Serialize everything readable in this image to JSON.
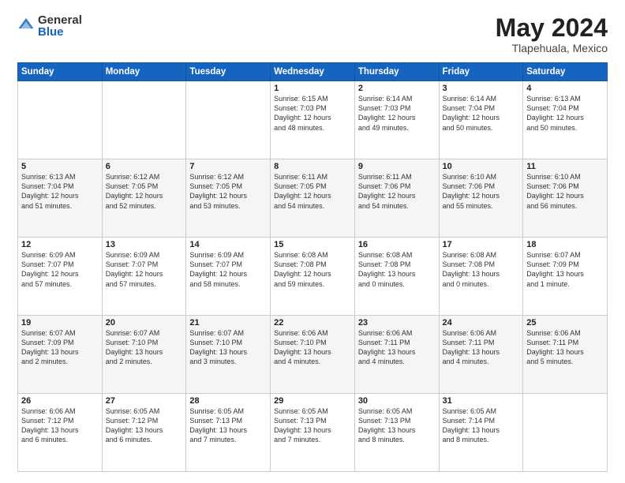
{
  "header": {
    "logo_general": "General",
    "logo_blue": "Blue",
    "title": "May 2024",
    "location": "Tlapehuala, Mexico"
  },
  "columns": [
    "Sunday",
    "Monday",
    "Tuesday",
    "Wednesday",
    "Thursday",
    "Friday",
    "Saturday"
  ],
  "weeks": [
    [
      {
        "day": "",
        "info": ""
      },
      {
        "day": "",
        "info": ""
      },
      {
        "day": "",
        "info": ""
      },
      {
        "day": "1",
        "info": "Sunrise: 6:15 AM\nSunset: 7:03 PM\nDaylight: 12 hours\nand 48 minutes."
      },
      {
        "day": "2",
        "info": "Sunrise: 6:14 AM\nSunset: 7:03 PM\nDaylight: 12 hours\nand 49 minutes."
      },
      {
        "day": "3",
        "info": "Sunrise: 6:14 AM\nSunset: 7:04 PM\nDaylight: 12 hours\nand 50 minutes."
      },
      {
        "day": "4",
        "info": "Sunrise: 6:13 AM\nSunset: 7:04 PM\nDaylight: 12 hours\nand 50 minutes."
      }
    ],
    [
      {
        "day": "5",
        "info": "Sunrise: 6:13 AM\nSunset: 7:04 PM\nDaylight: 12 hours\nand 51 minutes."
      },
      {
        "day": "6",
        "info": "Sunrise: 6:12 AM\nSunset: 7:05 PM\nDaylight: 12 hours\nand 52 minutes."
      },
      {
        "day": "7",
        "info": "Sunrise: 6:12 AM\nSunset: 7:05 PM\nDaylight: 12 hours\nand 53 minutes."
      },
      {
        "day": "8",
        "info": "Sunrise: 6:11 AM\nSunset: 7:05 PM\nDaylight: 12 hours\nand 54 minutes."
      },
      {
        "day": "9",
        "info": "Sunrise: 6:11 AM\nSunset: 7:06 PM\nDaylight: 12 hours\nand 54 minutes."
      },
      {
        "day": "10",
        "info": "Sunrise: 6:10 AM\nSunset: 7:06 PM\nDaylight: 12 hours\nand 55 minutes."
      },
      {
        "day": "11",
        "info": "Sunrise: 6:10 AM\nSunset: 7:06 PM\nDaylight: 12 hours\nand 56 minutes."
      }
    ],
    [
      {
        "day": "12",
        "info": "Sunrise: 6:09 AM\nSunset: 7:07 PM\nDaylight: 12 hours\nand 57 minutes."
      },
      {
        "day": "13",
        "info": "Sunrise: 6:09 AM\nSunset: 7:07 PM\nDaylight: 12 hours\nand 57 minutes."
      },
      {
        "day": "14",
        "info": "Sunrise: 6:09 AM\nSunset: 7:07 PM\nDaylight: 12 hours\nand 58 minutes."
      },
      {
        "day": "15",
        "info": "Sunrise: 6:08 AM\nSunset: 7:08 PM\nDaylight: 12 hours\nand 59 minutes."
      },
      {
        "day": "16",
        "info": "Sunrise: 6:08 AM\nSunset: 7:08 PM\nDaylight: 13 hours\nand 0 minutes."
      },
      {
        "day": "17",
        "info": "Sunrise: 6:08 AM\nSunset: 7:08 PM\nDaylight: 13 hours\nand 0 minutes."
      },
      {
        "day": "18",
        "info": "Sunrise: 6:07 AM\nSunset: 7:09 PM\nDaylight: 13 hours\nand 1 minute."
      }
    ],
    [
      {
        "day": "19",
        "info": "Sunrise: 6:07 AM\nSunset: 7:09 PM\nDaylight: 13 hours\nand 2 minutes."
      },
      {
        "day": "20",
        "info": "Sunrise: 6:07 AM\nSunset: 7:10 PM\nDaylight: 13 hours\nand 2 minutes."
      },
      {
        "day": "21",
        "info": "Sunrise: 6:07 AM\nSunset: 7:10 PM\nDaylight: 13 hours\nand 3 minutes."
      },
      {
        "day": "22",
        "info": "Sunrise: 6:06 AM\nSunset: 7:10 PM\nDaylight: 13 hours\nand 4 minutes."
      },
      {
        "day": "23",
        "info": "Sunrise: 6:06 AM\nSunset: 7:11 PM\nDaylight: 13 hours\nand 4 minutes."
      },
      {
        "day": "24",
        "info": "Sunrise: 6:06 AM\nSunset: 7:11 PM\nDaylight: 13 hours\nand 4 minutes."
      },
      {
        "day": "25",
        "info": "Sunrise: 6:06 AM\nSunset: 7:11 PM\nDaylight: 13 hours\nand 5 minutes."
      }
    ],
    [
      {
        "day": "26",
        "info": "Sunrise: 6:06 AM\nSunset: 7:12 PM\nDaylight: 13 hours\nand 6 minutes."
      },
      {
        "day": "27",
        "info": "Sunrise: 6:05 AM\nSunset: 7:12 PM\nDaylight: 13 hours\nand 6 minutes."
      },
      {
        "day": "28",
        "info": "Sunrise: 6:05 AM\nSunset: 7:13 PM\nDaylight: 13 hours\nand 7 minutes."
      },
      {
        "day": "29",
        "info": "Sunrise: 6:05 AM\nSunset: 7:13 PM\nDaylight: 13 hours\nand 7 minutes."
      },
      {
        "day": "30",
        "info": "Sunrise: 6:05 AM\nSunset: 7:13 PM\nDaylight: 13 hours\nand 8 minutes."
      },
      {
        "day": "31",
        "info": "Sunrise: 6:05 AM\nSunset: 7:14 PM\nDaylight: 13 hours\nand 8 minutes."
      },
      {
        "day": "",
        "info": ""
      }
    ]
  ]
}
